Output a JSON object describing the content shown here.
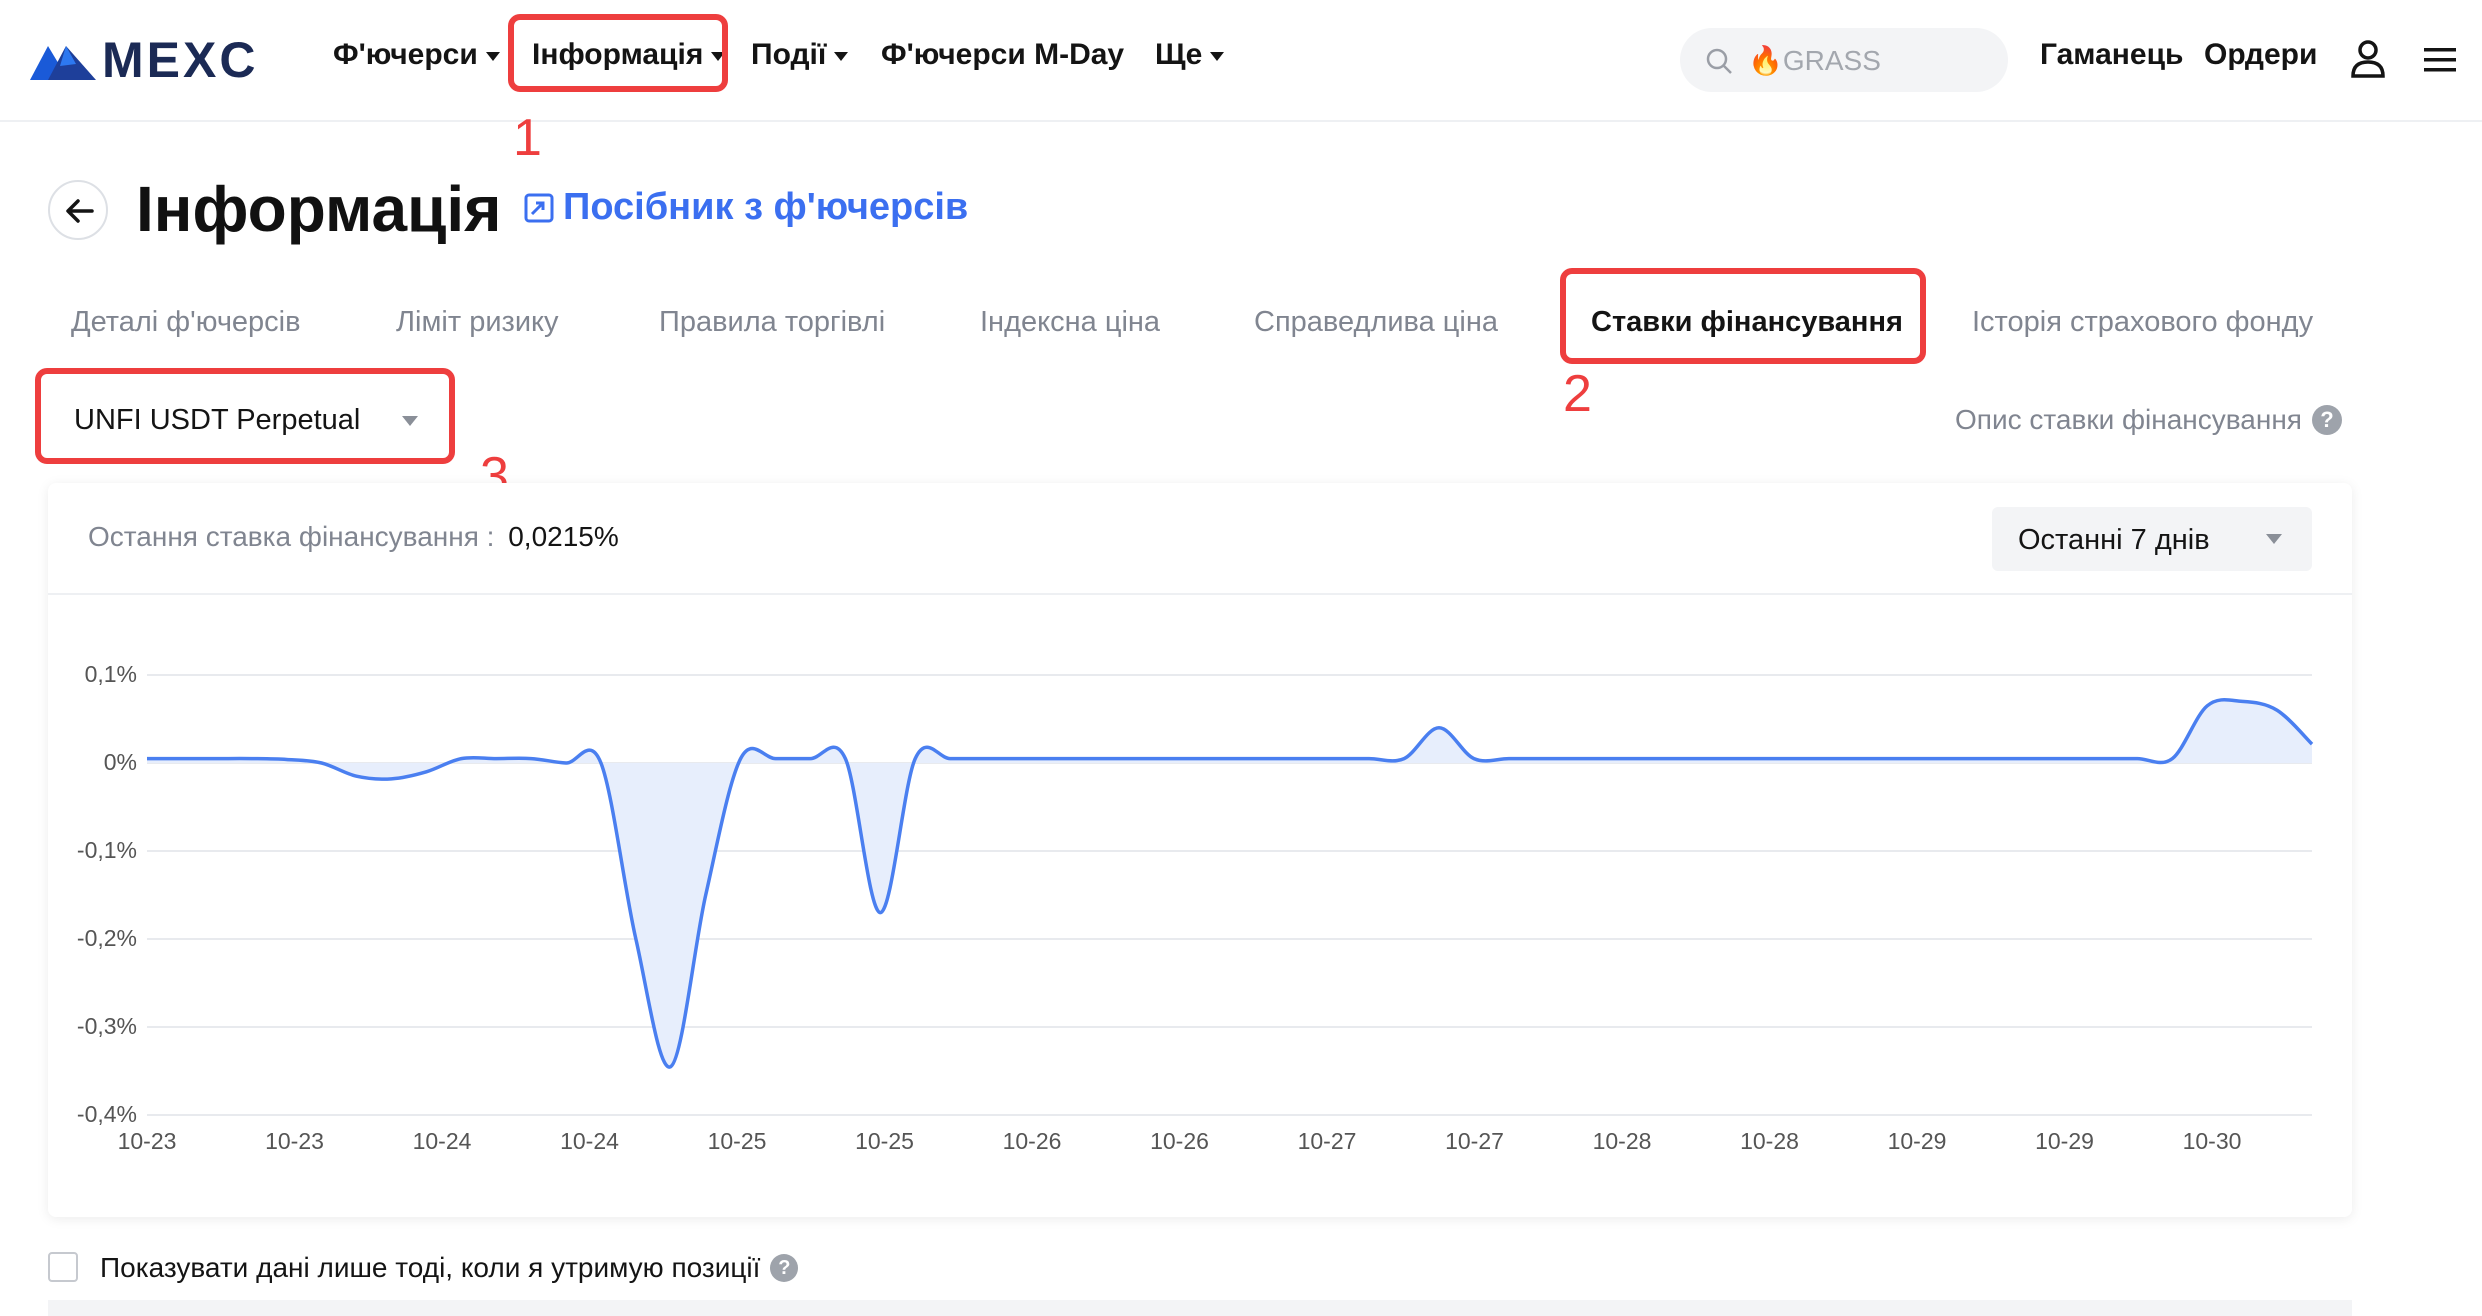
{
  "header": {
    "brand": "MEXC",
    "nav": [
      {
        "label": "Ф'ючерси",
        "caret": true
      },
      {
        "label": "Інформація",
        "caret": true
      },
      {
        "label": "Події",
        "caret": true
      },
      {
        "label": "Ф'ючерси M-Day",
        "caret": false
      },
      {
        "label": "Ще",
        "caret": true
      }
    ],
    "search_placeholder": "🔥GRASS",
    "wallet": "Гаманець",
    "orders": "Ордери"
  },
  "annotations": {
    "step1": "1",
    "step2": "2",
    "step3": "3"
  },
  "page": {
    "title": "Інформація",
    "guide_link": "Посібник з ф'ючерсів",
    "tabs": [
      "Деталі ф'ючерсів",
      "Ліміт ризику",
      "Правила торгівлі",
      "Індексна ціна",
      "Справедлива ціна",
      "Ставки фінансування",
      "Історія страхового фонду"
    ],
    "active_tab": "Ставки фінансування",
    "contract_select": "UNFI USDT Perpetual",
    "description_link": "Опис ставки фінансування"
  },
  "panel": {
    "last_rate_label": "Остання ставка фінансування :",
    "last_rate_value": "0,0215%",
    "period_select": "Останні 7 днів",
    "show_only_positions": "Показувати дані лише тоді, коли я утримую позиції"
  },
  "colors": {
    "accent": "#3b6ff0",
    "line": "#4a7ff0",
    "area": "#e7eefc",
    "annotation": "#ee3e3e"
  },
  "chart_data": {
    "type": "area",
    "title": "",
    "xlabel": "",
    "ylabel": "",
    "ylim": [
      -0.4,
      0.1
    ],
    "y_ticks": [
      "0,1%",
      "0%",
      "-0,1%",
      "-0,2%",
      "-0,3%",
      "-0,4%"
    ],
    "x_ticks": [
      "10-23",
      "10-23",
      "10-24",
      "10-24",
      "10-25",
      "10-25",
      "10-26",
      "10-26",
      "10-27",
      "10-27",
      "10-28",
      "10-28",
      "10-29",
      "10-29",
      "10-30"
    ],
    "series": [
      {
        "values": [
          0.005,
          0.005,
          0.005,
          0.005,
          0.004,
          0.0,
          -0.015,
          -0.018,
          -0.01,
          0.005,
          0.005,
          0.005,
          0.0,
          0.0,
          -0.2,
          -0.345,
          -0.15,
          0.005,
          0.005,
          0.005,
          0.005,
          -0.17,
          0.005,
          0.005,
          0.005,
          0.005,
          0.005,
          0.005,
          0.005,
          0.005,
          0.005,
          0.005,
          0.005,
          0.005,
          0.005,
          0.005,
          0.005,
          0.04,
          0.005,
          0.005,
          0.005,
          0.005,
          0.005,
          0.005,
          0.005,
          0.005,
          0.005,
          0.005,
          0.005,
          0.005,
          0.005,
          0.005,
          0.005,
          0.005,
          0.005,
          0.005,
          0.005,
          0.005,
          0.005,
          0.065,
          0.07,
          0.06,
          0.0215
        ]
      }
    ]
  }
}
